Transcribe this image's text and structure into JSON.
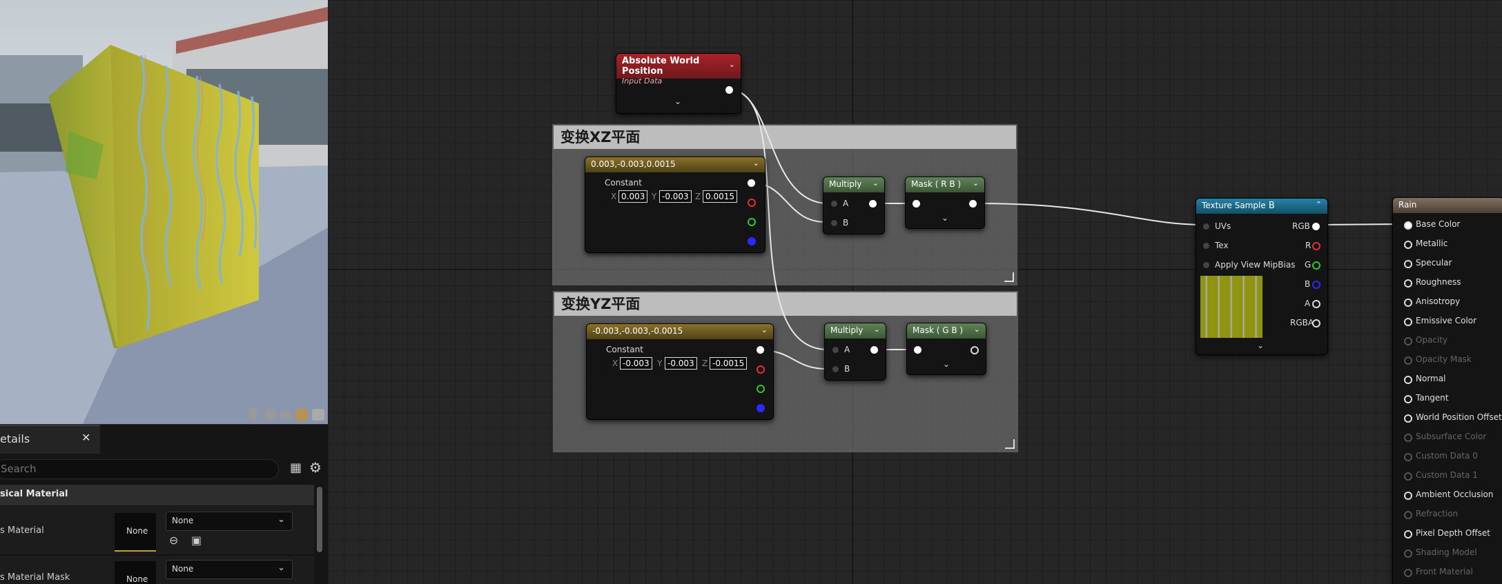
{
  "details_panel": {
    "tab_label": "etails",
    "search_placeholder": "Search",
    "section_title": "sical Material",
    "rows": [
      {
        "label": "s Material",
        "thumb": "None",
        "value": "None"
      },
      {
        "label": "s Material Mask",
        "thumb": "None",
        "value": "None"
      }
    ]
  },
  "graph": {
    "comments": [
      {
        "title": "变换XZ平面"
      },
      {
        "title": "变换YZ平面"
      }
    ],
    "abs_world_pos": {
      "title": "Absolute World Position",
      "subtitle": "Input Data"
    },
    "const1": {
      "title": "0.003,-0.003,0.0015",
      "label": "Constant",
      "x": "0.003",
      "y": "-0.003",
      "z": "0.0015"
    },
    "const2": {
      "title": "-0.003,-0.003,-0.0015",
      "label": "Constant",
      "x": "-0.003",
      "y": "-0.003",
      "z": "-0.0015"
    },
    "multiply1": {
      "title": "Multiply",
      "a": "A",
      "b": "B"
    },
    "multiply2": {
      "title": "Multiply",
      "a": "A",
      "b": "B"
    },
    "mask1": {
      "title": "Mask ( R B )"
    },
    "mask2": {
      "title": "Mask ( G B )"
    },
    "texture_sample": {
      "title": "Texture Sample",
      "inputs": [
        "UVs",
        "Tex",
        "Apply View MipBias"
      ],
      "outputs": [
        "RGB",
        "R",
        "G",
        "B",
        "A",
        "RGBA"
      ]
    },
    "result": {
      "title": "Rain",
      "inputs": [
        {
          "label": "Base Color",
          "enabled": true
        },
        {
          "label": "Metallic",
          "enabled": true
        },
        {
          "label": "Specular",
          "enabled": true
        },
        {
          "label": "Roughness",
          "enabled": true
        },
        {
          "label": "Anisotropy",
          "enabled": true
        },
        {
          "label": "Emissive Color",
          "enabled": true
        },
        {
          "label": "Opacity",
          "enabled": false
        },
        {
          "label": "Opacity Mask",
          "enabled": false
        },
        {
          "label": "Normal",
          "enabled": true
        },
        {
          "label": "Tangent",
          "enabled": true
        },
        {
          "label": "World Position Offset",
          "enabled": true
        },
        {
          "label": "Subsurface Color",
          "enabled": false
        },
        {
          "label": "Custom Data 0",
          "enabled": false
        },
        {
          "label": "Custom Data 1",
          "enabled": false
        },
        {
          "label": "Ambient Occlusion",
          "enabled": true
        },
        {
          "label": "Refraction",
          "enabled": false
        },
        {
          "label": "Pixel Depth Offset",
          "enabled": true
        },
        {
          "label": "Shading Model",
          "enabled": false
        },
        {
          "label": "Front Material",
          "enabled": false
        }
      ]
    }
  },
  "colors": {
    "abs_header": "#8e1e22",
    "const_header": "#6b5a1e",
    "math_header": "#4f6e48",
    "texture_header": "#1d6a8a",
    "result_header": "#7a6a5a",
    "pin_red": "#e53030",
    "pin_green": "#32c832",
    "pin_blue": "#2a2aff"
  }
}
